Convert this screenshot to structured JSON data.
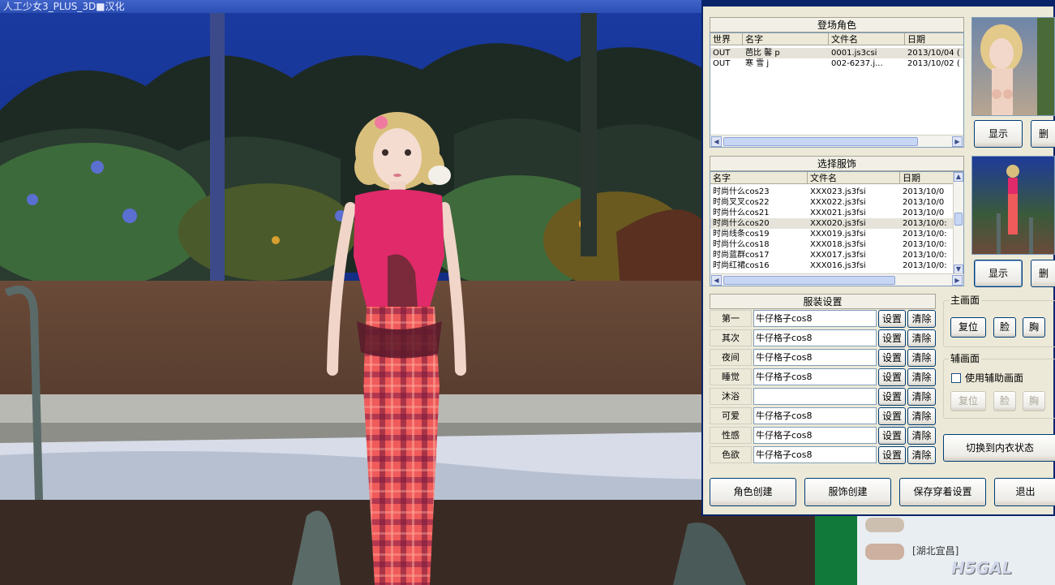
{
  "game_window": {
    "title": "人工少女3_PLUS_3D■汉化"
  },
  "dialog": {
    "title": "",
    "cast_section": {
      "header": "登场角色",
      "columns": [
        "世界",
        "名字",
        "文件名",
        "日期"
      ],
      "rows": [
        {
          "world": "OUT",
          "name": "芭比 馨 p",
          "file": "0001.js3csi",
          "date": "2013/10/04 ("
        },
        {
          "world": "OUT",
          "name": "寒 雪 j",
          "file": "002-6237.j...",
          "date": "2013/10/02 ("
        }
      ]
    },
    "outfit_section": {
      "header": "选择服饰",
      "columns": [
        "名字",
        "文件名",
        "日期"
      ],
      "rows": [
        {
          "name": "时尚什么cos23",
          "file": "XXX023.js3fsi",
          "date": "2013/10/0"
        },
        {
          "name": "时尚叉叉cos22",
          "file": "XXX022.js3fsi",
          "date": "2013/10/0"
        },
        {
          "name": "时尚什么cos21",
          "file": "XXX021.js3fsi",
          "date": "2013/10/0"
        },
        {
          "name": "时尚什么cos20",
          "file": "XXX020.js3fsi",
          "date": "2013/10/0:"
        },
        {
          "name": "时尚线条cos19",
          "file": "XXX019.js3fsi",
          "date": "2013/10/0:"
        },
        {
          "name": "时尚什么cos18",
          "file": "XXX018.js3fsi",
          "date": "2013/10/0:"
        },
        {
          "name": "时尚蓝群cos17",
          "file": "XXX017.js3fsi",
          "date": "2013/10/0:"
        },
        {
          "name": "时尚红裙cos16",
          "file": "XXX016.js3fsi",
          "date": "2013/10/0:"
        }
      ]
    },
    "clothing_settings": {
      "header": "服装设置",
      "set_label": "设置",
      "clear_label": "清除",
      "slots": [
        {
          "label": "第一",
          "value": "牛仔格子cos8"
        },
        {
          "label": "其次",
          "value": "牛仔格子cos8"
        },
        {
          "label": "夜间",
          "value": "牛仔格子cos8"
        },
        {
          "label": "睡觉",
          "value": "牛仔格子cos8"
        },
        {
          "label": "沐浴",
          "value": ""
        },
        {
          "label": "可爱",
          "value": "牛仔格子cos8"
        },
        {
          "label": "性感",
          "value": "牛仔格子cos8"
        },
        {
          "label": "色欲",
          "value": "牛仔格子cos8"
        }
      ]
    },
    "preview_top": {
      "show_label": "显示",
      "delete_label": "删"
    },
    "preview_bottom": {
      "show_label": "显示",
      "delete_label": "删"
    },
    "main_view": {
      "title": "主画面",
      "reset": "复位",
      "face": "脸",
      "chest": "胸"
    },
    "aux_view": {
      "title": "辅画面",
      "checkbox_label": "使用辅助画面",
      "checked": false,
      "reset": "复位",
      "face": "脸",
      "chest": "胸"
    },
    "underwear_toggle": "切换到内衣状态",
    "bottom_buttons": {
      "create_character": "角色创建",
      "create_outfit": "服饰创建",
      "save_wearing": "保存穿着设置",
      "exit": "退出"
    }
  },
  "chat": {
    "message": "[湖北宜昌]",
    "watermark": "H5GAL"
  },
  "colors": {
    "dialog_bg": "#ece9d8",
    "title_blue": "#0a246a",
    "selection": "#e6e3da"
  }
}
